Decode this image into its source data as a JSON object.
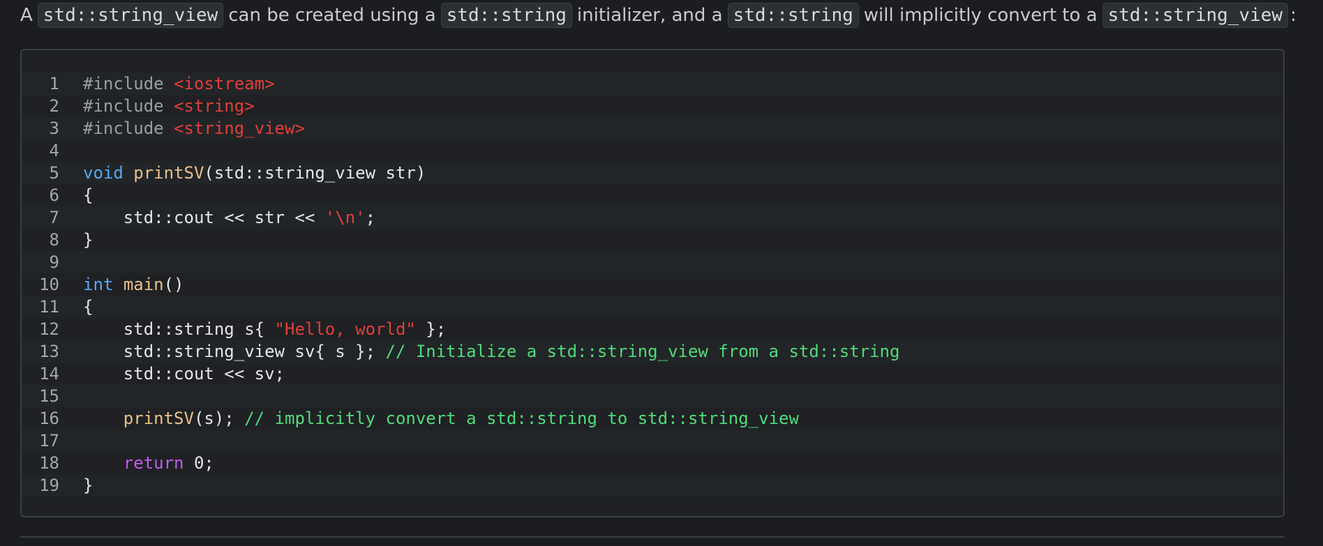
{
  "intro": {
    "t1": "A",
    "c1": "std::string_view",
    "t2": "can be created using a",
    "c2": "std::string",
    "t3": "initializer, and a",
    "c3": "std::string",
    "t4": "will implicitly convert to a",
    "c4": "std::string_view",
    "t5": ":"
  },
  "code": {
    "lines": [
      {
        "n": "1",
        "tokens": [
          {
            "t": "pre",
            "v": "#include "
          },
          {
            "t": "inc",
            "v": "<iostream>"
          }
        ]
      },
      {
        "n": "2",
        "tokens": [
          {
            "t": "pre",
            "v": "#include "
          },
          {
            "t": "inc",
            "v": "<string>"
          }
        ]
      },
      {
        "n": "3",
        "tokens": [
          {
            "t": "pre",
            "v": "#include "
          },
          {
            "t": "inc",
            "v": "<string_view>"
          }
        ]
      },
      {
        "n": "4",
        "tokens": []
      },
      {
        "n": "5",
        "tokens": [
          {
            "t": "kw",
            "v": "void"
          },
          {
            "t": "plain",
            "v": " "
          },
          {
            "t": "fn",
            "v": "printSV"
          },
          {
            "t": "plain",
            "v": "(std::string_view str)"
          }
        ]
      },
      {
        "n": "6",
        "tokens": [
          {
            "t": "plain",
            "v": "{"
          }
        ]
      },
      {
        "n": "7",
        "tokens": [
          {
            "t": "plain",
            "v": "    std::cout << str << "
          },
          {
            "t": "str",
            "v": "'\\n'"
          },
          {
            "t": "plain",
            "v": ";"
          }
        ]
      },
      {
        "n": "8",
        "tokens": [
          {
            "t": "plain",
            "v": "}"
          }
        ]
      },
      {
        "n": "9",
        "tokens": []
      },
      {
        "n": "10",
        "tokens": [
          {
            "t": "kw",
            "v": "int"
          },
          {
            "t": "plain",
            "v": " "
          },
          {
            "t": "fn",
            "v": "main"
          },
          {
            "t": "plain",
            "v": "()"
          }
        ]
      },
      {
        "n": "11",
        "tokens": [
          {
            "t": "plain",
            "v": "{"
          }
        ]
      },
      {
        "n": "12",
        "tokens": [
          {
            "t": "plain",
            "v": "    std::string s{ "
          },
          {
            "t": "str",
            "v": "\"Hello, world\""
          },
          {
            "t": "plain",
            "v": " };"
          }
        ]
      },
      {
        "n": "13",
        "tokens": [
          {
            "t": "plain",
            "v": "    std::string_view sv{ s }; "
          },
          {
            "t": "com",
            "v": "// Initialize a std::string_view from a std::string"
          }
        ]
      },
      {
        "n": "14",
        "tokens": [
          {
            "t": "plain",
            "v": "    std::cout << sv;"
          }
        ]
      },
      {
        "n": "15",
        "tokens": []
      },
      {
        "n": "16",
        "tokens": [
          {
            "t": "plain",
            "v": "    "
          },
          {
            "t": "fn",
            "v": "printSV"
          },
          {
            "t": "plain",
            "v": "(s); "
          },
          {
            "t": "com",
            "v": "// implicitly convert a std::string to std::string_view"
          }
        ]
      },
      {
        "n": "17",
        "tokens": []
      },
      {
        "n": "18",
        "tokens": [
          {
            "t": "plain",
            "v": "    "
          },
          {
            "t": "ret",
            "v": "return"
          },
          {
            "t": "plain",
            "v": " 0;"
          }
        ]
      },
      {
        "n": "19",
        "tokens": [
          {
            "t": "plain",
            "v": "}"
          }
        ]
      }
    ]
  }
}
